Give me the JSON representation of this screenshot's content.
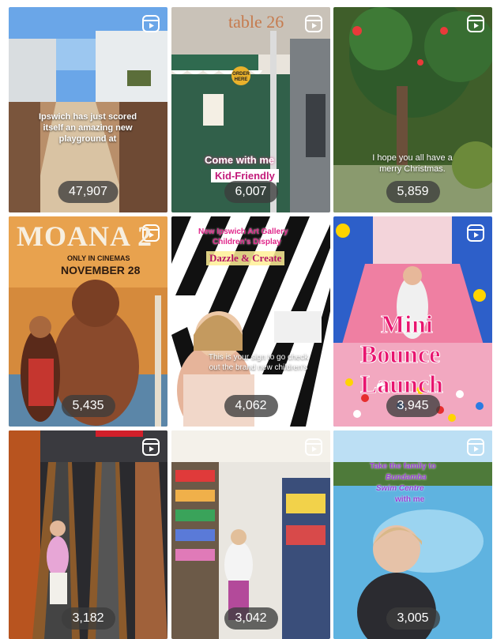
{
  "grid": {
    "tiles": [
      {
        "views": "47,907",
        "caption": "Ipswich has just scored itself an amazing new playground at"
      },
      {
        "views": "6,007",
        "caption_line1": "Come with me",
        "caption_line2": "Kid-Friendly",
        "sign": "table 26",
        "sign_badge": "ORDER HERE"
      },
      {
        "views": "5,859",
        "caption": "I hope you all have a merry Christmas."
      },
      {
        "views": "5,435",
        "title": "MOANA 2",
        "subtitle": "ONLY IN CINEMAS",
        "date": "NOVEMBER 28"
      },
      {
        "views": "4,062",
        "caption_line1": "New Ipswich Art Gallery",
        "caption_line2": "Children's Display",
        "caption_line3": "Dazzle & Create",
        "bottom_caption": "This is your sign to go check out the brand new children's"
      },
      {
        "views": "3,945",
        "caption_line1": "Mini",
        "caption_line2": "Bounce",
        "caption_line3": "Launch"
      },
      {
        "views": "3,182"
      },
      {
        "views": "3,042"
      },
      {
        "views": "3,005",
        "caption_line1": "Take the family to",
        "caption_line2": "Bundamba",
        "caption_line3": "Swim Centre",
        "caption_line4": "with me"
      }
    ]
  },
  "icons": {
    "reel": "reels-icon"
  }
}
